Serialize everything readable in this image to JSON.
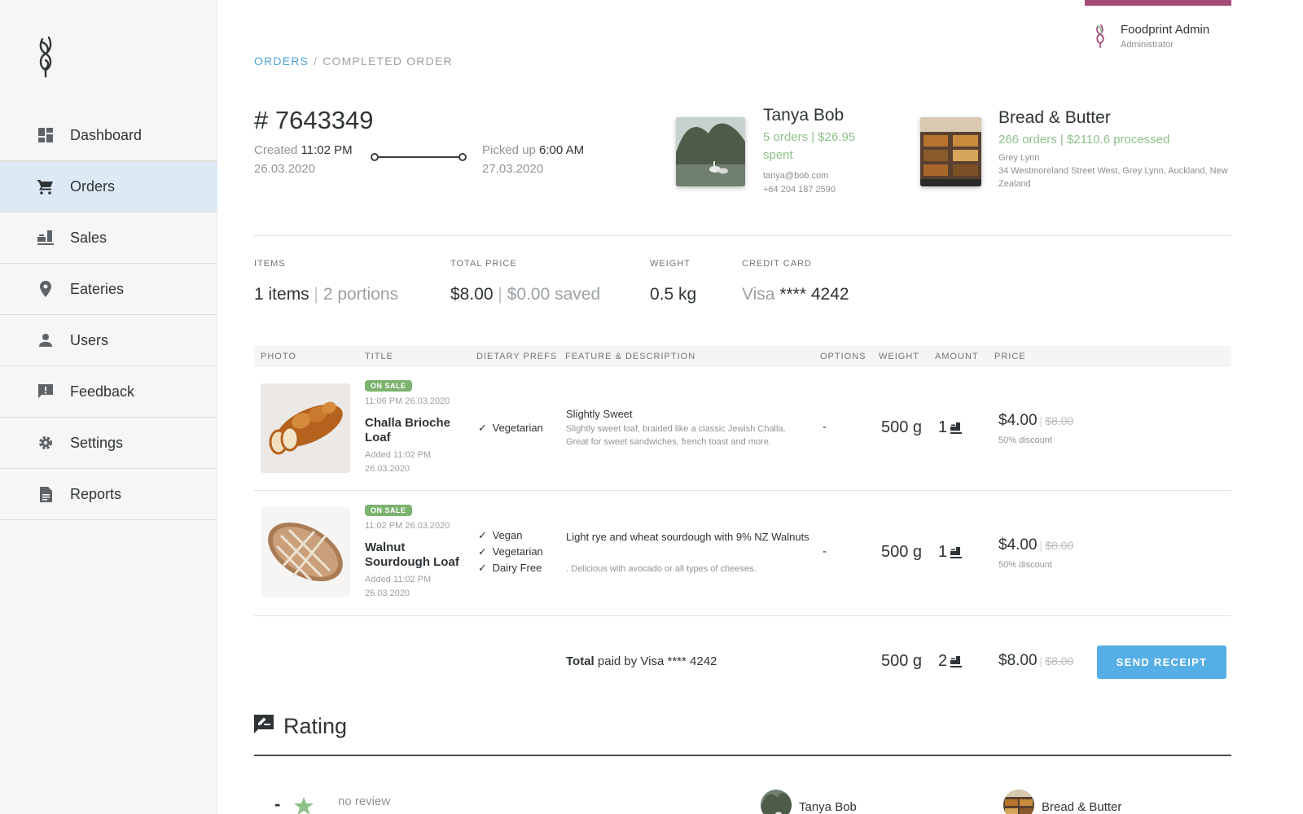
{
  "nav": {
    "items": [
      {
        "label": "Dashboard",
        "icon": "dashboard-icon"
      },
      {
        "label": "Orders",
        "icon": "cart-icon"
      },
      {
        "label": "Sales",
        "icon": "sales-icon"
      },
      {
        "label": "Eateries",
        "icon": "location-pin-icon"
      },
      {
        "label": "Users",
        "icon": "user-icon"
      },
      {
        "label": "Feedback",
        "icon": "feedback-icon"
      },
      {
        "label": "Settings",
        "icon": "gear-icon"
      },
      {
        "label": "Reports",
        "icon": "document-icon"
      }
    ],
    "active": "Orders"
  },
  "user": {
    "name": "Foodprint Admin",
    "role": "Administrator"
  },
  "breadcrumb": {
    "root": "ORDERS",
    "separator": "/",
    "current": "COMPLETED ORDER"
  },
  "order": {
    "number": "# 7643349",
    "created_label": "Created",
    "created_time": "11:02 PM",
    "created_date": "26.03.2020",
    "picked_label": "Picked up",
    "picked_time": "6:00 AM",
    "picked_date": "27.03.2020"
  },
  "customer": {
    "name": "Tanya Bob",
    "stats": "5 orders | $26.95 spent",
    "email": "tanya@bob.com",
    "phone": "+64 204 187 2590"
  },
  "eatery": {
    "name": "Bread & Butter",
    "stats": "266 orders | $2110.6 processed",
    "suburb": "Grey Lynn",
    "address": "34 Westmoreland Street West, Grey Lynn, Auckland, New Zealand"
  },
  "summary": {
    "items": {
      "label": "ITEMS",
      "value": "1 items",
      "sep": "|",
      "secondary": "2 portions"
    },
    "total": {
      "label": "TOTAL PRICE",
      "value": "$8.00",
      "sep": "|",
      "secondary": "$0.00 saved"
    },
    "weight": {
      "label": "WEIGHT",
      "value": "0.5 kg"
    },
    "card": {
      "label": "CREDIT CARD",
      "brand": "Visa",
      "number": "**** 4242"
    }
  },
  "table": {
    "headers": [
      "PHOTO",
      "TITLE",
      "DIETARY PREFS",
      "FEATURE & DESCRIPTION",
      "OPTIONS",
      "WEIGHT",
      "AMOUNT",
      "PRICE"
    ],
    "rows": [
      {
        "badge": "ON SALE",
        "timestamp": "11:06 PM 26.03.2020",
        "title": "Challa Brioche Loaf",
        "added": "Added 11:02 PM 26.03.2020",
        "dietary": [
          "Vegetarian"
        ],
        "feature": "Slightly Sweet",
        "description": "Slightly sweet loaf, braided like a classic Jewish Challa. Great for sweet sandwiches, french toast and more.",
        "options": "-",
        "weight": "500 g",
        "amount": "1",
        "price": "$4.00",
        "price_sep": "|",
        "old_price": "$8.00",
        "discount": "50% discount"
      },
      {
        "badge": "ON SALE",
        "timestamp": "11:02 PM 26.03.2020",
        "title": "Walnut Sourdough Loaf",
        "added": "Added 11:02 PM 26.03.2020",
        "dietary": [
          "Vegan",
          "Vegetarian",
          "Dairy Free"
        ],
        "feature": "Light rye and wheat sourdough with 9% NZ Walnuts",
        "description": ". Delicious with avocado or all types of cheeses.",
        "options": "-",
        "weight": "500 g",
        "amount": "1",
        "price": "$4.00",
        "price_sep": "|",
        "old_price": "$8.00",
        "discount": "50% discount"
      }
    ]
  },
  "totals": {
    "label_bold": "Total",
    "label_rest": "paid by Visa **** 4242",
    "weight": "500 g",
    "amount": "2",
    "price": "$8.00",
    "price_sep": "|",
    "old_price": "$8.00",
    "button": "SEND RECEIPT"
  },
  "rating": {
    "title": "Rating",
    "score": "-",
    "review": "no review",
    "customer": "Tanya Bob",
    "eatery": "Bread & Butter"
  },
  "colors": {
    "accent_blue": "#56aee6",
    "link_blue": "#4ea3d9",
    "green": "#8fc18a",
    "badge_green": "#7cb36f",
    "brand_purple": "#a34b79",
    "active_nav": "#ddeaf5"
  }
}
